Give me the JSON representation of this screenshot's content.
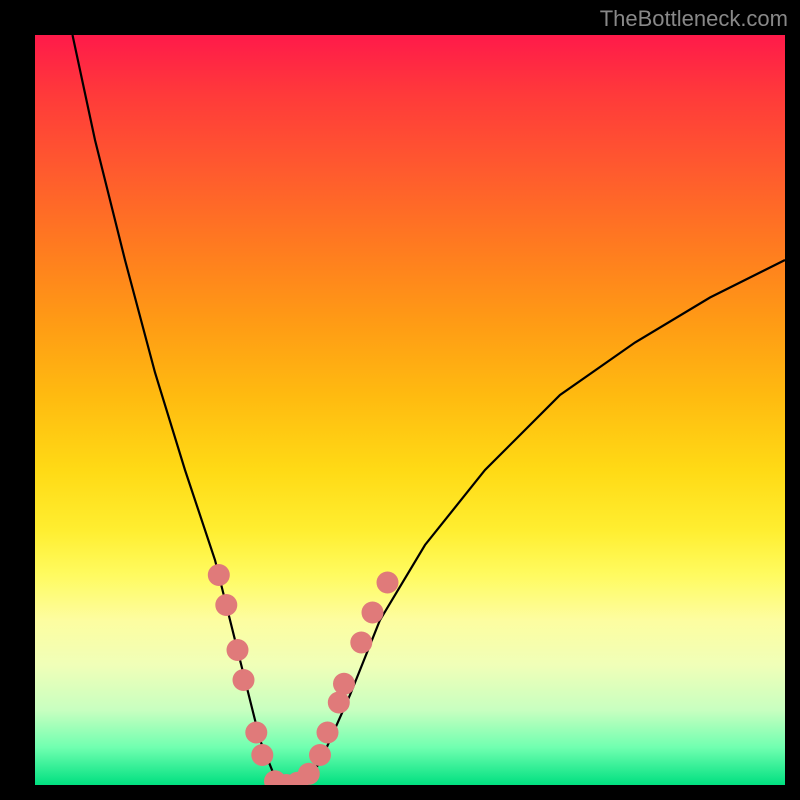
{
  "watermark": "TheBottleneck.com",
  "chart_data": {
    "type": "line",
    "title": "",
    "xlabel": "",
    "ylabel": "",
    "xlim": [
      0,
      100
    ],
    "ylim": [
      0,
      100
    ],
    "series": [
      {
        "name": "bottleneck-curve",
        "x": [
          5,
          8,
          12,
          16,
          20,
          24,
          26,
          28,
          30,
          32,
          34,
          36,
          38,
          42,
          46,
          52,
          60,
          70,
          80,
          90,
          100
        ],
        "y": [
          100,
          86,
          70,
          55,
          42,
          30,
          22,
          14,
          6,
          1,
          0,
          0.5,
          3,
          12,
          22,
          32,
          42,
          52,
          59,
          65,
          70
        ]
      }
    ],
    "markers": {
      "name": "highlight-dots",
      "color": "#e07a7a",
      "points": [
        {
          "x": 24.5,
          "y": 28
        },
        {
          "x": 25.5,
          "y": 24
        },
        {
          "x": 27.0,
          "y": 18
        },
        {
          "x": 27.8,
          "y": 14
        },
        {
          "x": 29.5,
          "y": 7
        },
        {
          "x": 30.3,
          "y": 4
        },
        {
          "x": 32.0,
          "y": 0.5
        },
        {
          "x": 33.5,
          "y": 0
        },
        {
          "x": 35.0,
          "y": 0.3
        },
        {
          "x": 36.5,
          "y": 1.5
        },
        {
          "x": 38.0,
          "y": 4
        },
        {
          "x": 39.0,
          "y": 7
        },
        {
          "x": 40.5,
          "y": 11
        },
        {
          "x": 41.2,
          "y": 13.5
        },
        {
          "x": 43.5,
          "y": 19
        },
        {
          "x": 45.0,
          "y": 23
        },
        {
          "x": 47.0,
          "y": 27
        }
      ]
    },
    "background": {
      "type": "vertical-gradient",
      "stops": [
        {
          "pos": 0,
          "color": "#ff1a4a"
        },
        {
          "pos": 50,
          "color": "#ffda15"
        },
        {
          "pos": 100,
          "color": "#00e080"
        }
      ]
    }
  }
}
